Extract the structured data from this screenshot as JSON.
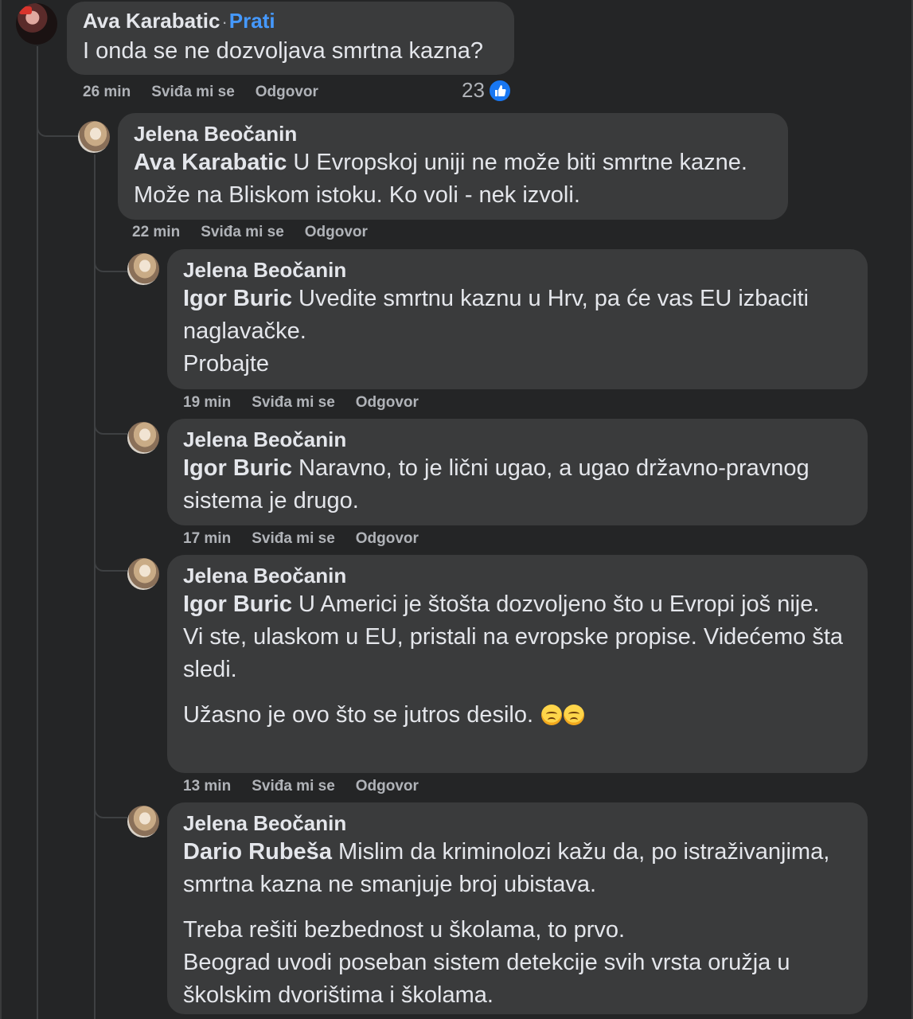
{
  "comments": [
    {
      "author": "Ava Karabatic",
      "follow_label": "Prati",
      "separator": "·",
      "text": "I onda se ne dozvoljava smrtna kazna?",
      "time": "26 min",
      "like_label": "Sviđa mi se",
      "reply_label": "Odgovor",
      "reaction_count": "23"
    },
    {
      "author": "Jelena Beočanin",
      "mention": "Ava Karabatic",
      "text": " U Evropskoj uniji ne može biti smrtne kazne.\nMože na Bliskom istoku. Ko voli - nek izvoli.",
      "time": "22 min",
      "like_label": "Sviđa mi se",
      "reply_label": "Odgovor"
    },
    {
      "author": "Jelena Beočanin",
      "mention": "Igor Buric",
      "text": " Uvedite smrtnu kaznu u Hrv, pa će vas EU izbaciti naglavačke.\nProbajte",
      "time": "19 min",
      "like_label": "Sviđa mi se",
      "reply_label": "Odgovor"
    },
    {
      "author": "Jelena Beočanin",
      "mention": "Igor Buric",
      "text": " Naravno, to je lični ugao, a ugao državno-pravnog sistema je drugo.",
      "time": "17 min",
      "like_label": "Sviđa mi se",
      "reply_label": "Odgovor"
    },
    {
      "author": "Jelena Beočanin",
      "mention": "Igor Buric",
      "text": " U Americi je štošta dozvoljeno što u Evropi još nije.\nVi ste, ulaskom u EU, pristali na evropske propise. Videćemo šta sledi.",
      "text2": "Užasno je ovo što se jutros desilo.",
      "time": "13 min",
      "like_label": "Sviđa mi se",
      "reply_label": "Odgovor"
    },
    {
      "author": "Jelena Beočanin",
      "mention": "Dario Rubeša",
      "text": " Mislim da kriminolozi kažu da, po istraživanjima, smrtna kazna ne smanjuje broj ubistava.",
      "text2": "Treba rešiti bezbednost u školama, to prvo.\nBeograd uvodi poseban sistem detekcije svih vrsta oružja u školskim dvorištima i školama."
    }
  ],
  "icons": {
    "like": "like-thumb-icon",
    "emoji": "sad-face-emoji-icon"
  }
}
